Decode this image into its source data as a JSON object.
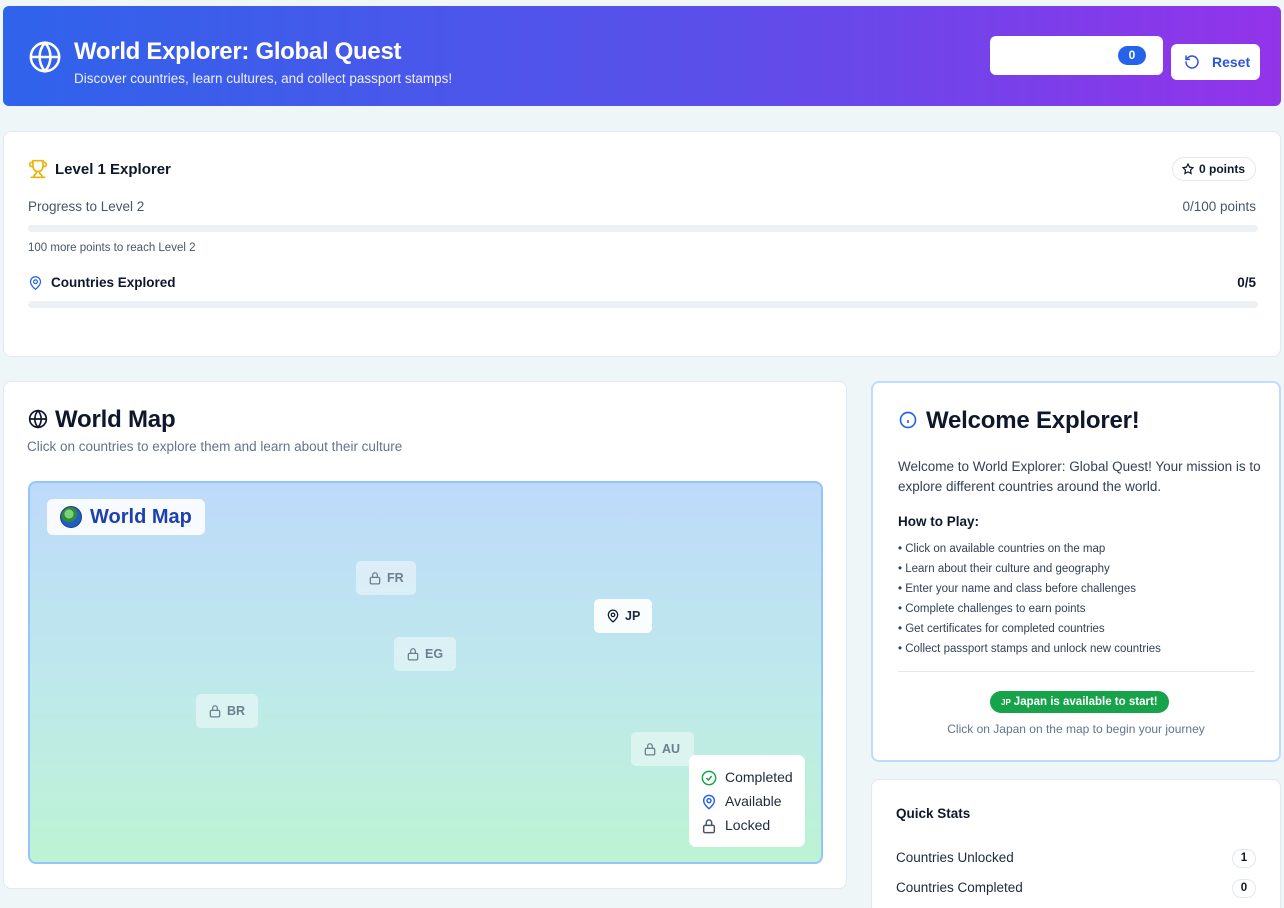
{
  "header": {
    "title": "World Explorer: Global Quest",
    "subtitle": "Discover countries, learn cultures, and collect passport stamps!",
    "stamp_count": "0",
    "reset_label": "Reset"
  },
  "progress": {
    "level_title": "Level 1 Explorer",
    "points_label": "0 points",
    "progress_label": "Progress to Level 2",
    "progress_value": "0/100 points",
    "progress_fraction": 0,
    "hint": "100 more points to reach Level 2",
    "countries_label": "Countries Explored",
    "countries_value": "0/5",
    "countries_fraction": 0
  },
  "map": {
    "title": "World Map",
    "description": "Click on countries to explore them and learn about their culture",
    "chip_label": "World Map",
    "countries": [
      {
        "code": "FR",
        "status": "locked"
      },
      {
        "code": "JP",
        "status": "available"
      },
      {
        "code": "EG",
        "status": "locked"
      },
      {
        "code": "BR",
        "status": "locked"
      },
      {
        "code": "AU",
        "status": "locked"
      }
    ],
    "legend": {
      "completed": "Completed",
      "available": "Available",
      "locked": "Locked"
    }
  },
  "welcome": {
    "title": "Welcome Explorer!",
    "text": "Welcome to World Explorer: Global Quest! Your mission is to explore different countries around the world.",
    "how_title": "How to Play:",
    "steps": [
      "• Click on available countries on the map",
      "• Learn about their culture and geography",
      "• Enter your name and class before challenges",
      "• Complete challenges to earn points",
      "• Get certificates for completed countries",
      "• Collect passport stamps and unlock new countries"
    ],
    "available_code": "JP",
    "available_text": "Japan is available to start!",
    "available_hint": "Click on Japan on the map to begin your journey"
  },
  "stats": {
    "title": "Quick Stats",
    "rows": [
      {
        "label": "Countries Unlocked",
        "value": "1"
      },
      {
        "label": "Countries Completed",
        "value": "0"
      }
    ]
  },
  "colors": {
    "primary": "#2563eb",
    "accent_purple": "#9333ea",
    "success": "#16a34a",
    "trophy": "#eab308"
  }
}
